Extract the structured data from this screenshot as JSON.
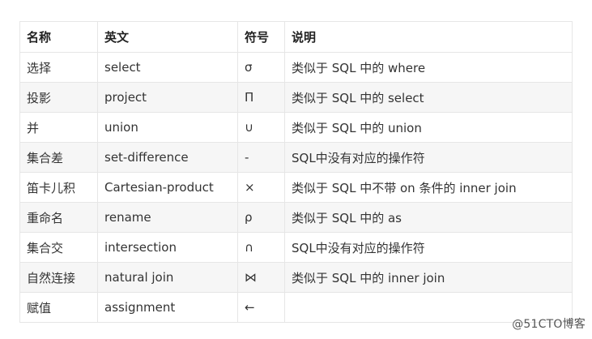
{
  "table": {
    "headers": [
      "名称",
      "英文",
      "符号",
      "说明"
    ],
    "rows": [
      [
        "选择",
        "select",
        "σ",
        "类似于 SQL 中的 where"
      ],
      [
        "投影",
        "project",
        "Π",
        "类似于 SQL 中的 select"
      ],
      [
        "并",
        "union",
        "∪",
        "类似于 SQL 中的 union"
      ],
      [
        "集合差",
        "set-difference",
        "-",
        "SQL中没有对应的操作符"
      ],
      [
        "笛卡儿积",
        "Cartesian-product",
        "×",
        "类似于 SQL 中不带 on 条件的 inner join"
      ],
      [
        "重命名",
        "rename",
        "ρ",
        "类似于 SQL 中的 as"
      ],
      [
        "集合交",
        "intersection",
        "∩",
        "SQL中没有对应的操作符"
      ],
      [
        "自然连接",
        "natural join",
        "⋈",
        "类似于 SQL 中的 inner join"
      ],
      [
        "赋值",
        "assignment",
        "←",
        ""
      ]
    ]
  },
  "watermark": "@51CTO博客"
}
